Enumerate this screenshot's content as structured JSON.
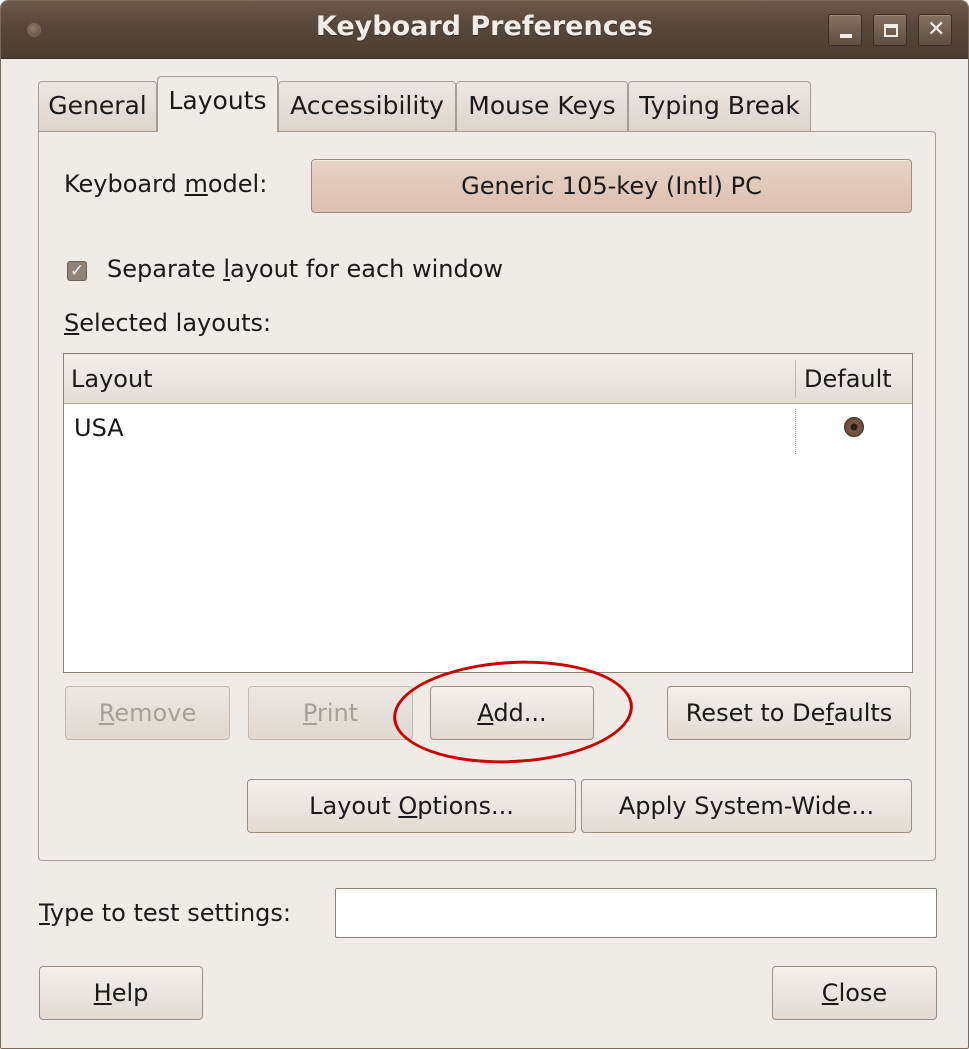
{
  "window": {
    "title": "Keyboard Preferences",
    "controls": {
      "minimize": "minimize-icon",
      "maximize": "maximize-icon",
      "close": "close-icon"
    }
  },
  "tabs": [
    {
      "label": "General",
      "active": false
    },
    {
      "label": "Layouts",
      "active": true
    },
    {
      "label": "Accessibility",
      "active": false
    },
    {
      "label": "Mouse Keys",
      "active": false
    },
    {
      "label": "Typing Break",
      "active": false
    }
  ],
  "keyboard_model": {
    "label_pre": "Keyboard ",
    "label_mnemonic": "m",
    "label_post": "odel:",
    "value": "Generic 105-key (Intl) PC"
  },
  "separate_layout": {
    "label_pre": "Separate ",
    "label_mnemonic": "l",
    "label_post": "ayout for each window",
    "checked": true
  },
  "selected_layouts": {
    "label_mnemonic": "S",
    "label_post": "elected layouts:",
    "columns": [
      "Layout",
      "Default"
    ],
    "rows": [
      {
        "layout": "USA",
        "default": true
      }
    ]
  },
  "buttons": {
    "remove": {
      "mnemonic": "R",
      "rest": "emove",
      "enabled": false
    },
    "print": {
      "mnemonic": "P",
      "rest": "rint",
      "enabled": false
    },
    "add": {
      "mnemonic": "A",
      "rest": "dd...",
      "enabled": true
    },
    "reset": {
      "pre": "Reset to De",
      "mnemonic": "f",
      "post": "aults"
    },
    "layout_options": {
      "pre": "Layout ",
      "mnemonic": "O",
      "post": "ptions..."
    },
    "apply_system_wide": {
      "label": "Apply System-Wide..."
    },
    "help": {
      "mnemonic": "H",
      "rest": "elp"
    },
    "close": {
      "mnemonic": "C",
      "rest": "lose"
    }
  },
  "test_settings": {
    "label_mnemonic": "T",
    "label_post": "ype to test settings:",
    "value": ""
  },
  "annotation": {
    "highlight_color": "#cc0000",
    "target": "add-button"
  }
}
